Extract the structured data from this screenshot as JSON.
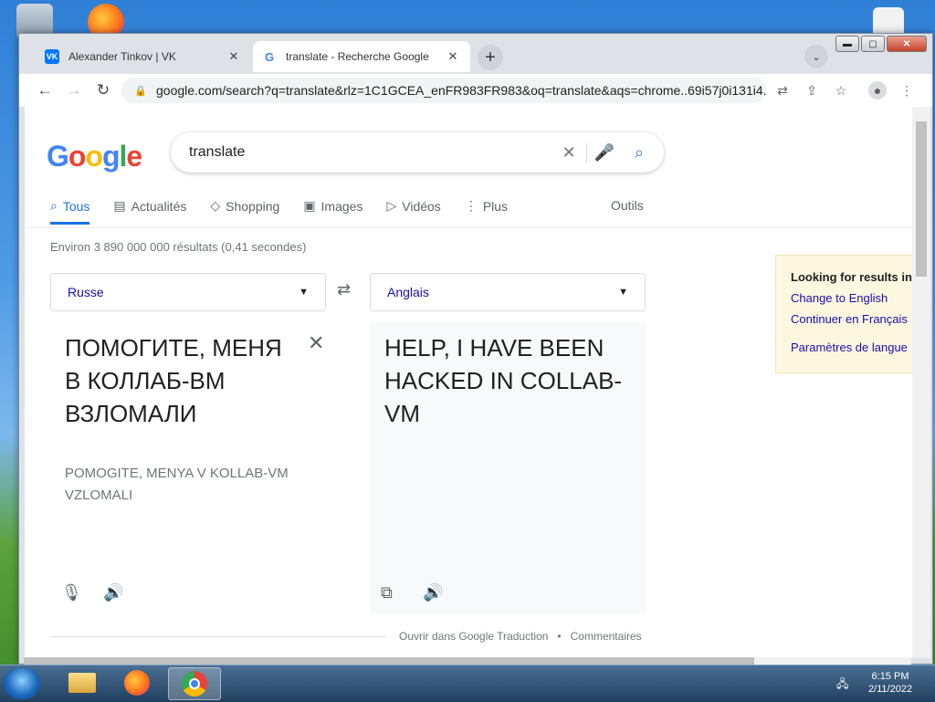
{
  "desktop": {
    "icons": [
      "recycle-bin-icon",
      "firefox-icon",
      "file-icon"
    ]
  },
  "browser": {
    "tabs": [
      {
        "title": "Alexander Tinkov | VK",
        "favicon": "VK",
        "close": "✕"
      },
      {
        "title": "translate - Recherche Google",
        "favicon": "G",
        "close": "✕"
      }
    ],
    "new_tab": "+",
    "tab_search": "⌄",
    "window_buttons": {
      "min": "▬",
      "max": "▢",
      "close": "✕"
    },
    "url": "google.com/search?q=translate&rlz=1C1GCEA_enFR983FR983&oq=translate&aqs=chrome..69i57j0i131i4..."
  },
  "search": {
    "logo": "Google",
    "query": "translate",
    "tabs": [
      "Tous",
      "Actualités",
      "Shopping",
      "Images",
      "Vidéos",
      "Plus"
    ],
    "tools": "Outils",
    "stats": "Environ 3 890 000 000 résultats (0,41 secondes)"
  },
  "translate": {
    "source_lang": "Russe",
    "target_lang": "Anglais",
    "source_text": "ПОМОГИТЕ, МЕНЯ В КОЛЛАБ-ВМ ВЗЛОМАЛИ",
    "transliteration": "POMOGITE, MENYA V KOLLAB-VM VZLOMALI",
    "target_text": "HELP, I HAVE BEEN HACKED IN COLLAB-VM",
    "open_link": "Ouvrir dans Google Traduction",
    "separator": "•",
    "feedback": "Commentaires"
  },
  "language_notice": {
    "heading": "Looking for results in",
    "link1": "Change to English",
    "link2": "Continuer en Français",
    "link3": "Paramètres de langue"
  },
  "taskbar": {
    "time": "6:15 PM",
    "date": "2/11/2022"
  },
  "colors": {
    "google_blue": "#4285f4",
    "google_red": "#ea4335",
    "google_yellow": "#fbbc05",
    "google_green": "#34a853",
    "link": "#1a0dab"
  }
}
